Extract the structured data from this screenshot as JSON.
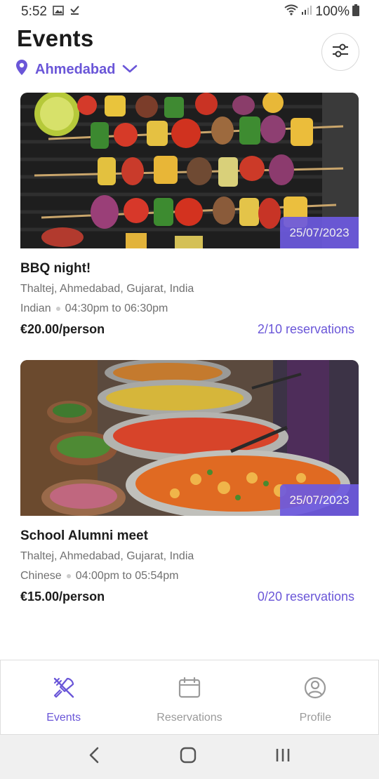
{
  "status_bar": {
    "time": "5:52",
    "battery": "100%"
  },
  "header": {
    "title": "Events",
    "location": "Ahmedabad"
  },
  "events": [
    {
      "name": "BBQ night!",
      "date": "25/07/2023",
      "address": "Thaltej, Ahmedabad, Gujarat, India",
      "cuisine": "Indian",
      "time": "04:30pm to 06:30pm",
      "price": "€20.00/person",
      "reservations": "2/10 reservations"
    },
    {
      "name": "School Alumni meet",
      "date": "25/07/2023",
      "address": "Thaltej, Ahmedabad, Gujarat, India",
      "cuisine": "Chinese",
      "time": "04:00pm to 05:54pm",
      "price": "€15.00/person",
      "reservations": "0/20 reservations"
    }
  ],
  "bottom_nav": [
    {
      "label": "Events",
      "icon": "fork-knife-icon",
      "active": true
    },
    {
      "label": "Reservations",
      "icon": "calendar-icon",
      "active": false
    },
    {
      "label": "Profile",
      "icon": "user-circle-icon",
      "active": false
    }
  ],
  "colors": {
    "accent": "#6a56d8",
    "badge": "#6d5ae0"
  }
}
